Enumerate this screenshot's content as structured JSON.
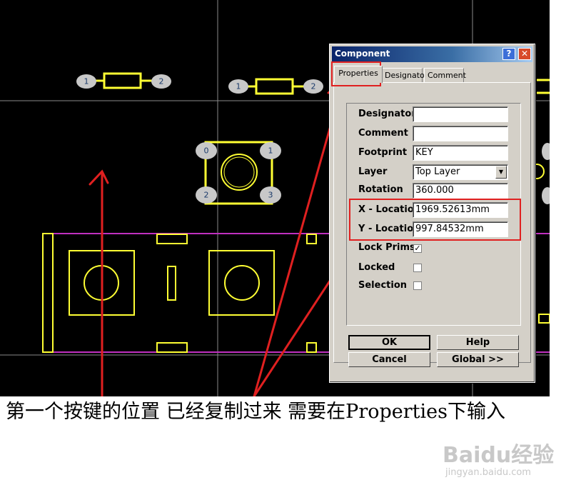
{
  "dialog": {
    "title": "Component",
    "help_glyph": "?",
    "close_glyph": "✕",
    "tabs": [
      "Properties",
      "Designator",
      "Comment"
    ]
  },
  "fields": {
    "designator": {
      "label": "Designator",
      "value": ""
    },
    "comment": {
      "label": "Comment",
      "value": ""
    },
    "footprint": {
      "label": "Footprint",
      "value": "KEY"
    },
    "layer": {
      "label": "Layer",
      "value": "Top Layer"
    },
    "rotation": {
      "label": "Rotation",
      "value": "360.000"
    },
    "x_location": {
      "label": "X - Location",
      "value": "1969.52613mm"
    },
    "y_location": {
      "label": "Y - Location",
      "value": "997.84532mm"
    }
  },
  "checkboxes": {
    "lock_prims": {
      "label": "Lock Prims",
      "checked": true,
      "mark": "✓"
    },
    "locked": {
      "label": "Locked",
      "checked": false,
      "mark": ""
    },
    "selection": {
      "label": "Selection",
      "checked": false,
      "mark": ""
    }
  },
  "buttons": {
    "ok": "OK",
    "help": "Help",
    "cancel": "Cancel",
    "global": "Global >>"
  },
  "pads": [
    "1",
    "2",
    "1",
    "2",
    "0",
    "1",
    "2",
    "3"
  ],
  "caption": "第一个按键的位置 已经复制过来 需要在Properties下输入",
  "watermark": {
    "logo": "Baidu经验",
    "url": "jingyan.baidu.com"
  },
  "colors": {
    "canvas": "#000000",
    "component": "#ffff33",
    "pad": "#c8c8c8",
    "board_edge": "#c030c0",
    "annotation": "#e02020",
    "titlebar": "#0a246a"
  }
}
